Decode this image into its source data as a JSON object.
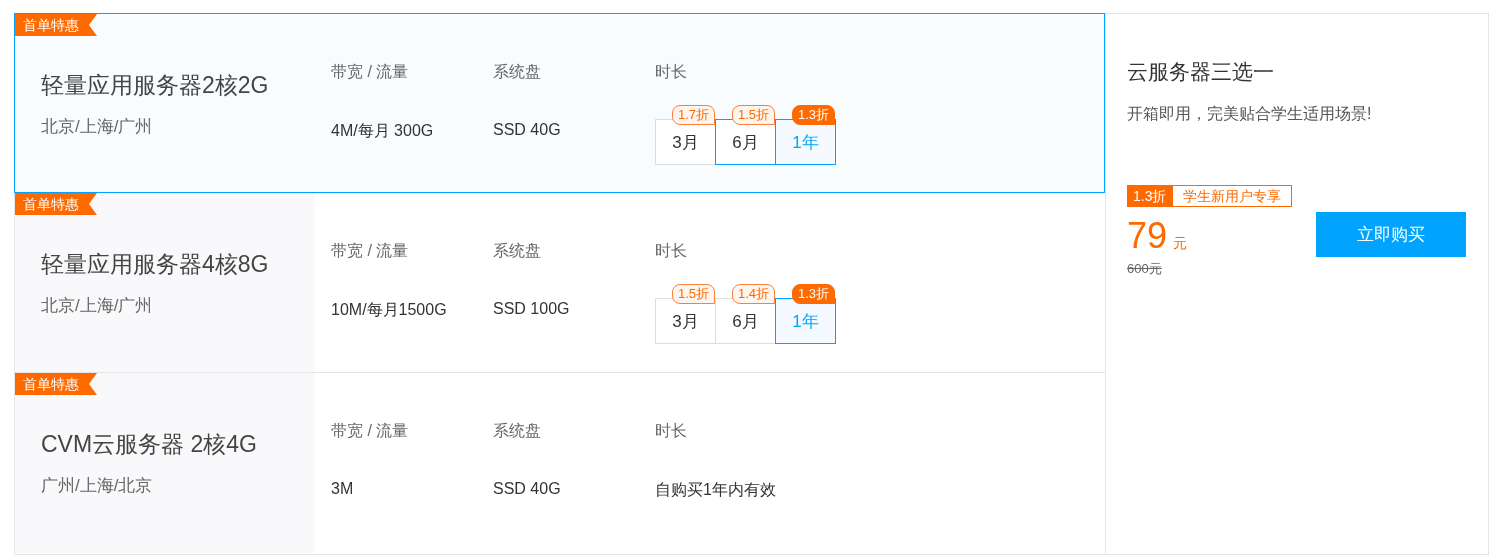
{
  "products": [
    {
      "badge": "首单特惠",
      "name": "轻量应用服务器2核2G",
      "regions": "北京/上海/广州",
      "selected": true,
      "bandwidth_label": "带宽 / 流量",
      "bandwidth": "4M/每月 300G",
      "disk_label": "系统盘",
      "disk": "SSD 40G",
      "duration_label": "时长",
      "kind": "options",
      "options": [
        {
          "label": "3月",
          "discount": "1.7折",
          "selected": false,
          "hovered": false
        },
        {
          "label": "6月",
          "discount": "1.5折",
          "selected": false,
          "hovered": true
        },
        {
          "label": "1年",
          "discount": "1.3折",
          "selected": true,
          "hovered": false
        }
      ]
    },
    {
      "badge": "首单特惠",
      "name": "轻量应用服务器4核8G",
      "regions": "北京/上海/广州",
      "selected": false,
      "bandwidth_label": "带宽 / 流量",
      "bandwidth": "10M/每月1500G",
      "disk_label": "系统盘",
      "disk": "SSD 100G",
      "duration_label": "时长",
      "kind": "options",
      "options": [
        {
          "label": "3月",
          "discount": "1.5折",
          "selected": false,
          "hovered": false
        },
        {
          "label": "6月",
          "discount": "1.4折",
          "selected": false,
          "hovered": false
        },
        {
          "label": "1年",
          "discount": "1.3折",
          "selected": true,
          "hovered": false
        }
      ]
    },
    {
      "badge": "首单特惠",
      "name": "CVM云服务器 2核4G",
      "regions": "广州/上海/北京",
      "selected": false,
      "bandwidth_label": "带宽 / 流量",
      "bandwidth": "3M",
      "disk_label": "系统盘",
      "disk": "SSD 40G",
      "duration_label": "时长",
      "kind": "text",
      "duration_text": "自购买1年内有效"
    }
  ],
  "summary": {
    "title": "云服务器三选一",
    "subtitle": "开箱即用，完美贴合学生适用场景!",
    "discount": "1.3折",
    "tag": "学生新用户专享",
    "price": "79",
    "unit": "元",
    "original_price": "600元",
    "buy_button": "立即购买"
  }
}
